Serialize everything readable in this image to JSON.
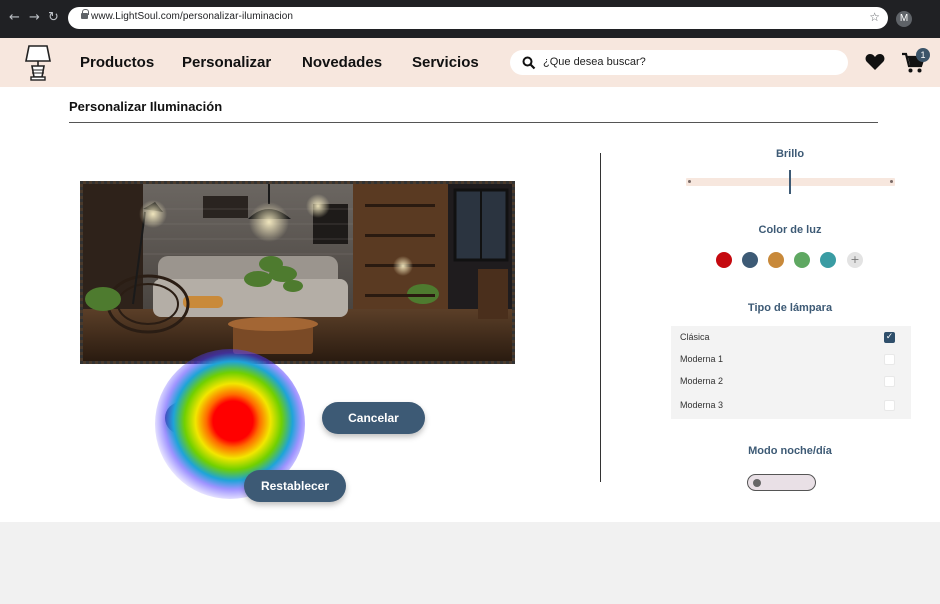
{
  "browser": {
    "nav_back": "←",
    "nav_forward": "→",
    "nav_reload": "↻",
    "url": "www.LightSoul.com/personalizar-iluminacion",
    "star": "☆",
    "avatar_letter": "M"
  },
  "header": {
    "logo_icon": "lamp-icon",
    "menu": [
      "Productos",
      "Personalizar",
      "Novedades",
      "Servicios"
    ],
    "search_placeholder": "¿Que desea buscar?",
    "cart_count": "1"
  },
  "page": {
    "title": "Personalizar Iluminación"
  },
  "buttons": {
    "save_partial": "G",
    "cancel": "Cancelar",
    "reset": "Restablecer"
  },
  "controls": {
    "brightness_label": "Brillo",
    "brightness_level": 0.5,
    "color_label": "Color de luz",
    "colors": [
      "#c5090f",
      "#3d5a75",
      "#c8893a",
      "#5fa862",
      "#3a9ca3"
    ],
    "add_color": "+",
    "lamp_type_label": "Tipo de lámpara",
    "lamp_types": [
      {
        "label": "Clásica",
        "checked": true
      },
      {
        "label": "Moderna 1",
        "checked": false
      },
      {
        "label": "Moderna 2",
        "checked": false
      },
      {
        "label": "Moderna 3",
        "checked": false
      }
    ],
    "mode_label": "Modo noche/día",
    "mode_on": false
  },
  "colors": {
    "header_bg": "#f7e7de",
    "accent": "#3d5a75"
  }
}
